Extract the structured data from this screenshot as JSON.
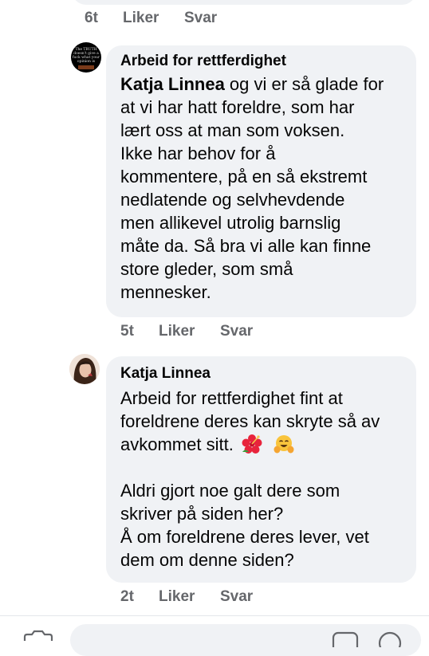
{
  "top_comment": {
    "time": "6t",
    "like": "Liker",
    "reply": "Svar"
  },
  "comments": [
    {
      "author": "Arbeid for rettferdighet",
      "avatar_text": "The TRUTH doesn't give a fuck what your opinion is",
      "mention": "Katja Linnea",
      "lines": [
        " og vi er så glade for",
        "at vi har hatt foreldre, som har",
        "lært oss at man som voksen.",
        "Ikke har behov for å",
        "kommentere, på en så ekstremt",
        "nedlatende og selvhevdende",
        "men allikevel utrolig barnslig",
        "måte da. Så bra vi alle kan finne",
        "store gleder, som små",
        "mennesker."
      ],
      "time": "5t",
      "like": "Liker",
      "reply": "Svar"
    },
    {
      "author": "Katja Linnea",
      "lines": [
        "Arbeid for rettferdighet fint at",
        "foreldrene deres kan skryte så av",
        "avkommet sitt.",
        "",
        "Aldri gjort noe galt dere som",
        "skriver på siden her?",
        "Å om foreldrene deres lever, vet",
        "dem om denne siden?"
      ],
      "emojis": [
        "hibiscus-emoji",
        "smiling-face-with-open-hands-emoji"
      ],
      "time": "2t",
      "like": "Liker",
      "reply": "Svar"
    }
  ],
  "colors": {
    "bubble": "#f0f2f5",
    "meta": "#65676b",
    "text": "#050505"
  }
}
